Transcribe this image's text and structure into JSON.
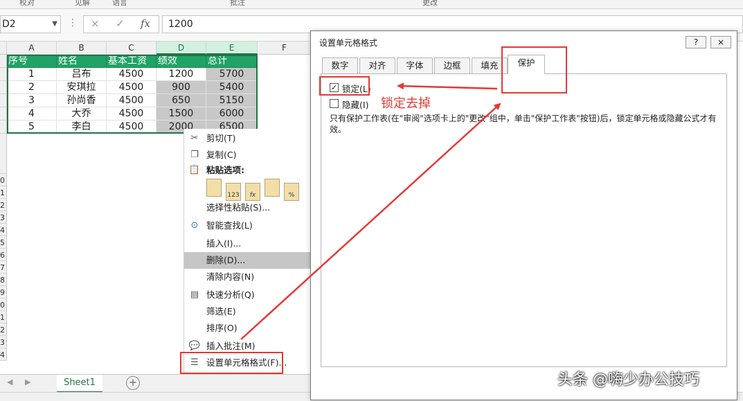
{
  "ribbon": {
    "groups": [
      "校对",
      "见解",
      "语言",
      "批注",
      "更改"
    ]
  },
  "formula_bar": {
    "name_box": "D2",
    "cancel_icon": "×",
    "enter_icon": "✓",
    "function_icon": "fx",
    "value": "1200"
  },
  "sheet": {
    "columns": [
      "A",
      "B",
      "C",
      "D",
      "E",
      "F"
    ],
    "row_numbers": [
      "",
      "",
      "",
      "",
      "",
      "",
      "",
      "0",
      "1",
      "2",
      "3",
      "4",
      "5",
      "6",
      "7",
      "8",
      "9",
      "0",
      "1",
      "2",
      "3",
      "4"
    ],
    "headers": [
      "序号",
      "姓名",
      "基本工资",
      "绩效",
      "总计"
    ],
    "rows": [
      [
        "1",
        "吕布",
        "4500",
        "1200",
        "5700"
      ],
      [
        "2",
        "安琪拉",
        "4500",
        "900",
        "5400"
      ],
      [
        "3",
        "孙尚香",
        "4500",
        "650",
        "5150"
      ],
      [
        "4",
        "大乔",
        "4500",
        "1500",
        "6000"
      ],
      [
        "5",
        "李白",
        "4500",
        "2000",
        "6500"
      ]
    ]
  },
  "context_menu": {
    "items": [
      {
        "icon": "scissors-icon",
        "label": "剪切(T)"
      },
      {
        "icon": "copy-icon",
        "label": "复制(C)"
      },
      {
        "icon": "paste-icon",
        "label": "粘贴选项:"
      },
      {
        "icon": "",
        "label": "选择性粘贴(S)..."
      },
      {
        "icon": "smart-lookup-icon",
        "label": "智能查找(L)"
      },
      {
        "icon": "",
        "label": "插入(I)..."
      },
      {
        "icon": "",
        "label": "删除(D)..."
      },
      {
        "icon": "",
        "label": "清除内容(N)"
      },
      {
        "icon": "quick-analysis-icon",
        "label": "快速分析(Q)"
      },
      {
        "icon": "",
        "label": "筛选(E)"
      },
      {
        "icon": "",
        "label": "排序(O)"
      },
      {
        "icon": "insert-comment-icon",
        "label": "插入批注(M)"
      },
      {
        "icon": "format-cells-icon",
        "label": "设置单元格格式(F)..."
      }
    ],
    "paste_options": [
      "",
      "123",
      "fx",
      "",
      "%"
    ]
  },
  "sheet_tabs": {
    "active": "Sheet1",
    "add_label": "+"
  },
  "dialog": {
    "title": "设置单元格格式",
    "help_label": "?",
    "close_label": "×",
    "tabs": [
      "数字",
      "对齐",
      "字体",
      "边框",
      "填充",
      "保护"
    ],
    "active_tab": "保护",
    "locked_label": "锁定(L)",
    "locked_checked": true,
    "hidden_label": "隐藏(I)",
    "hidden_checked": false,
    "note": "只有保护工作表(在\"审阅\"选项卡上的\"更改\"组中，单击\"保护工作表\"按钮)后，锁定单元格或隐藏公式才有效。"
  },
  "annotation": {
    "text": "锁定去掉",
    "color": "#e53935"
  },
  "watermark": "头条 @嗨少办公技巧",
  "colors": {
    "excel_green": "#21a366",
    "selection_grey": "#c8c8c8",
    "accent_red": "#e53935"
  }
}
